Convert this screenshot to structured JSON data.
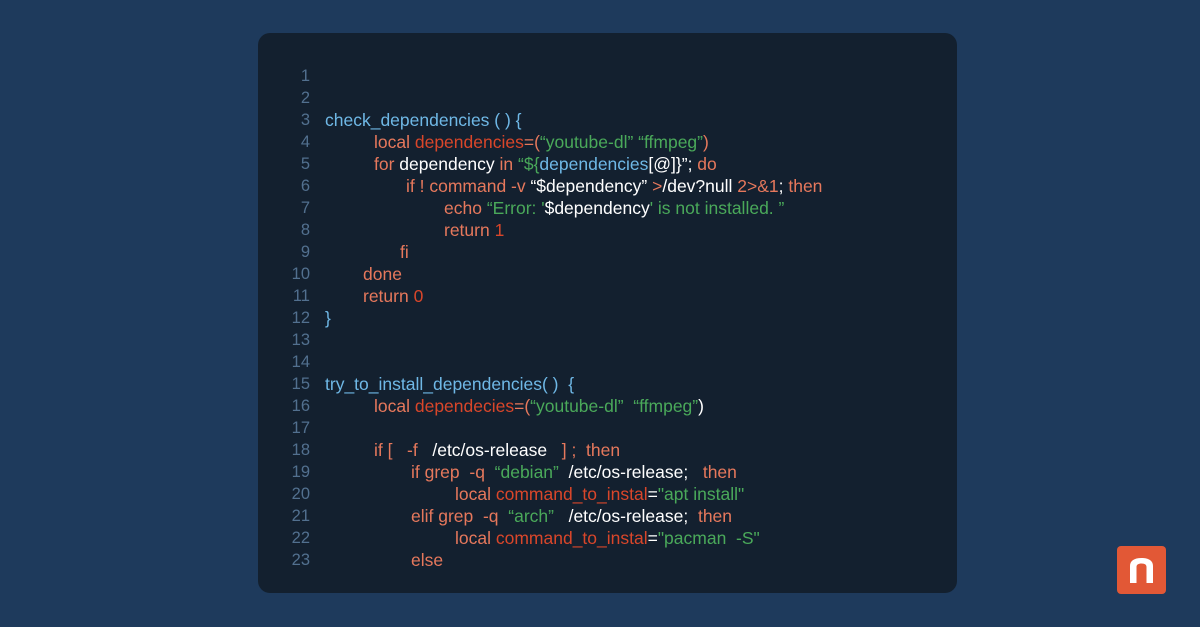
{
  "editor": {
    "lines": [
      {
        "n": "1",
        "indent": 0,
        "tokens": []
      },
      {
        "n": "2",
        "indent": 0,
        "tokens": []
      },
      {
        "n": "3",
        "indent": 0,
        "tokens": [
          {
            "t": "check_dependencies ( ) {",
            "c": "b"
          }
        ]
      },
      {
        "n": "4",
        "indent": 1,
        "tokens": [
          {
            "t": "local ",
            "c": "k"
          },
          {
            "t": "dependencies",
            "c": "v"
          },
          {
            "t": "=(",
            "c": "k"
          },
          {
            "t": "“youtube-dl” “ffmpeg”",
            "c": "s"
          },
          {
            "t": ")",
            "c": "k"
          }
        ]
      },
      {
        "n": "5",
        "indent": 1,
        "tokens": [
          {
            "t": "for ",
            "c": "k"
          },
          {
            "t": "dependency ",
            "c": "w"
          },
          {
            "t": "in ",
            "c": "k"
          },
          {
            "t": "“${",
            "c": "s"
          },
          {
            "t": "dependencies",
            "c": "b"
          },
          {
            "t": "[@]}”; ",
            "c": "w"
          },
          {
            "t": "do",
            "c": "k"
          }
        ]
      },
      {
        "n": "6",
        "indent": 2,
        "tokens": [
          {
            "t": "if ! command -v ",
            "c": "k"
          },
          {
            "t": "“$dependency” ",
            "c": "w"
          },
          {
            "t": ">",
            "c": "k"
          },
          {
            "t": "/dev?null ",
            "c": "w"
          },
          {
            "t": "2>&1",
            "c": "k"
          },
          {
            "t": "; ",
            "c": "w"
          },
          {
            "t": "then",
            "c": "k"
          }
        ]
      },
      {
        "n": "7",
        "indent": 3,
        "tokens": [
          {
            "t": "echo ",
            "c": "k"
          },
          {
            "t": "“Error: '",
            "c": "s"
          },
          {
            "t": "$dependency",
            "c": "w"
          },
          {
            "t": "' is not installed. ”",
            "c": "s"
          }
        ]
      },
      {
        "n": "8",
        "indent": 3,
        "tokens": [
          {
            "t": "return ",
            "c": "k"
          },
          {
            "t": "1",
            "c": "v"
          }
        ]
      },
      {
        "n": "9",
        "indent": 4,
        "tokens": [
          {
            "t": "fi",
            "c": "k"
          }
        ]
      },
      {
        "n": "10",
        "indent": 5,
        "tokens": [
          {
            "t": "done",
            "c": "k"
          }
        ]
      },
      {
        "n": "11",
        "indent": 5,
        "tokens": [
          {
            "t": "return ",
            "c": "k"
          },
          {
            "t": "0",
            "c": "v"
          }
        ]
      },
      {
        "n": "12",
        "indent": 0,
        "tokens": [
          {
            "t": "}",
            "c": "b"
          }
        ]
      },
      {
        "n": "13",
        "indent": 0,
        "tokens": []
      },
      {
        "n": "14",
        "indent": 0,
        "tokens": []
      },
      {
        "n": "15",
        "indent": 0,
        "tokens": [
          {
            "t": "try_to_install_dependencies( )  {",
            "c": "b"
          }
        ]
      },
      {
        "n": "16",
        "indent": 1,
        "tokens": [
          {
            "t": "local ",
            "c": "k"
          },
          {
            "t": "dependecies",
            "c": "v"
          },
          {
            "t": "=(",
            "c": "k"
          },
          {
            "t": "“youtube-dl”  “ffmpeg”",
            "c": "s"
          },
          {
            "t": ")",
            "c": "w"
          }
        ]
      },
      {
        "n": "17",
        "indent": 0,
        "tokens": []
      },
      {
        "n": "18",
        "indent": 1,
        "tokens": [
          {
            "t": "if [   -f   ",
            "c": "k"
          },
          {
            "t": "/etc/os-release   ",
            "c": "w"
          },
          {
            "t": "] ;  then",
            "c": "k"
          }
        ]
      },
      {
        "n": "19",
        "indent": 6,
        "tokens": [
          {
            "t": "if grep  -q  ",
            "c": "k"
          },
          {
            "t": "“debian”  ",
            "c": "s"
          },
          {
            "t": "/etc/os-release;   ",
            "c": "w"
          },
          {
            "t": "then",
            "c": "k"
          }
        ]
      },
      {
        "n": "20",
        "indent": 7,
        "tokens": [
          {
            "t": "local ",
            "c": "k"
          },
          {
            "t": "command_to_instal",
            "c": "v"
          },
          {
            "t": "=",
            "c": "w"
          },
          {
            "t": "\"apt install\"",
            "c": "s"
          }
        ]
      },
      {
        "n": "21",
        "indent": 6,
        "tokens": [
          {
            "t": "elif grep  -q  ",
            "c": "k"
          },
          {
            "t": "“arch”   ",
            "c": "s"
          },
          {
            "t": "/etc/os-release;  ",
            "c": "w"
          },
          {
            "t": "then",
            "c": "k"
          }
        ]
      },
      {
        "n": "22",
        "indent": 7,
        "tokens": [
          {
            "t": "local ",
            "c": "k"
          },
          {
            "t": "command_to_instal",
            "c": "v"
          },
          {
            "t": "=",
            "c": "w"
          },
          {
            "t": "\"pacman  -S\"",
            "c": "s"
          }
        ]
      },
      {
        "n": "23",
        "indent": 6,
        "tokens": [
          {
            "t": "else",
            "c": "k"
          }
        ]
      }
    ]
  },
  "logo": {
    "icon": "n-logo-icon",
    "color": "#e25836"
  },
  "colors": {
    "background": "#1e3a5c",
    "editor_bg": "#13202f",
    "keyword": "#e6785c",
    "variable": "#d9462a",
    "string": "#4aa95a",
    "function": "#6fb8e6",
    "line_number": "#52708f"
  }
}
